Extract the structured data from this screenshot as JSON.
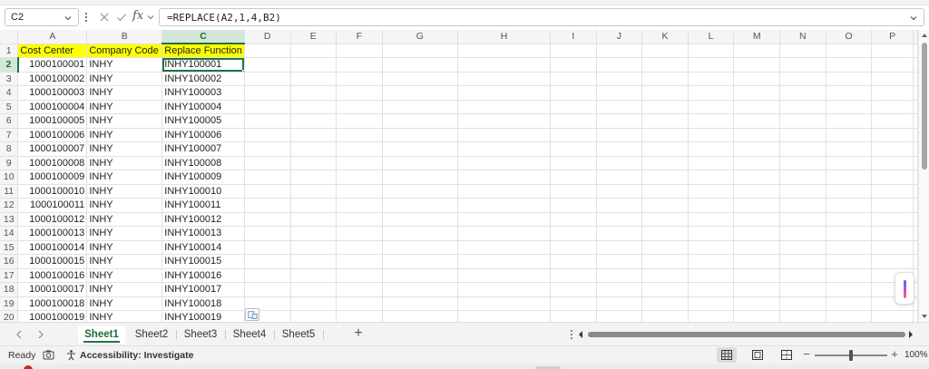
{
  "formula_bar": {
    "name_box": "C2",
    "formula": "=REPLACE(A2,1,4,B2)"
  },
  "columns": [
    "A",
    "B",
    "C",
    "D",
    "E",
    "F",
    "G",
    "H",
    "I",
    "J",
    "K",
    "L",
    "M",
    "N",
    "O",
    "P"
  ],
  "selected_cell": {
    "column": "C",
    "row": 2
  },
  "headers": {
    "A": "Cost Center",
    "B": "Company Code",
    "C": "Replace Function"
  },
  "rows": [
    {
      "num": "1",
      "a": "Cost Center",
      "b": "Company Code",
      "c": "Replace Function"
    },
    {
      "num": "2",
      "a": "1000100001",
      "b": "INHY",
      "c": "INHY100001"
    },
    {
      "num": "3",
      "a": "1000100002",
      "b": "INHY",
      "c": "INHY100002"
    },
    {
      "num": "4",
      "a": "1000100003",
      "b": "INHY",
      "c": "INHY100003"
    },
    {
      "num": "5",
      "a": "1000100004",
      "b": "INHY",
      "c": "INHY100004"
    },
    {
      "num": "6",
      "a": "1000100005",
      "b": "INHY",
      "c": "INHY100005"
    },
    {
      "num": "7",
      "a": "1000100006",
      "b": "INHY",
      "c": "INHY100006"
    },
    {
      "num": "8",
      "a": "1000100007",
      "b": "INHY",
      "c": "INHY100007"
    },
    {
      "num": "9",
      "a": "1000100008",
      "b": "INHY",
      "c": "INHY100008"
    },
    {
      "num": "10",
      "a": "1000100009",
      "b": "INHY",
      "c": "INHY100009"
    },
    {
      "num": "11",
      "a": "1000100010",
      "b": "INHY",
      "c": "INHY100010"
    },
    {
      "num": "12",
      "a": "1000100011",
      "b": "INHY",
      "c": "INHY100011"
    },
    {
      "num": "13",
      "a": "1000100012",
      "b": "INHY",
      "c": "INHY100012"
    },
    {
      "num": "14",
      "a": "1000100013",
      "b": "INHY",
      "c": "INHY100013"
    },
    {
      "num": "15",
      "a": "1000100014",
      "b": "INHY",
      "c": "INHY100014"
    },
    {
      "num": "16",
      "a": "1000100015",
      "b": "INHY",
      "c": "INHY100015"
    },
    {
      "num": "17",
      "a": "1000100016",
      "b": "INHY",
      "c": "INHY100016"
    },
    {
      "num": "18",
      "a": "1000100017",
      "b": "INHY",
      "c": "INHY100017"
    },
    {
      "num": "19",
      "a": "1000100018",
      "b": "INHY",
      "c": "INHY100018"
    },
    {
      "num": "20",
      "a": "1000100019",
      "b": "INHY",
      "c": "INHY100019"
    }
  ],
  "sheet_tabs": [
    "Sheet1",
    "Sheet2",
    "Sheet3",
    "Sheet4",
    "Sheet5"
  ],
  "active_sheet": "Sheet1",
  "status_bar": {
    "ready": "Ready",
    "accessibility": "Accessibility: Investigate",
    "zoom": "100%",
    "zoom_fraction": 0.5
  },
  "icons": {
    "name_box_dropdown": "chevron-down-icon",
    "cancel": "close-icon",
    "enter": "check-icon",
    "insert_function": "fx-icon",
    "formula_expand": "chevron-down-icon",
    "add_sheet": "plus-icon",
    "paste_options": "clipboard-icon",
    "accessibility": "accessibility-icon",
    "macro": "camera-icon",
    "copilot": "copilot-icon"
  },
  "colors": {
    "header_fill": "#ffff00",
    "accent": "#217346",
    "selected_header": "#d3e7d8"
  },
  "glyphs": {
    "fx": "fx",
    "minus": "−",
    "plus": "+"
  }
}
